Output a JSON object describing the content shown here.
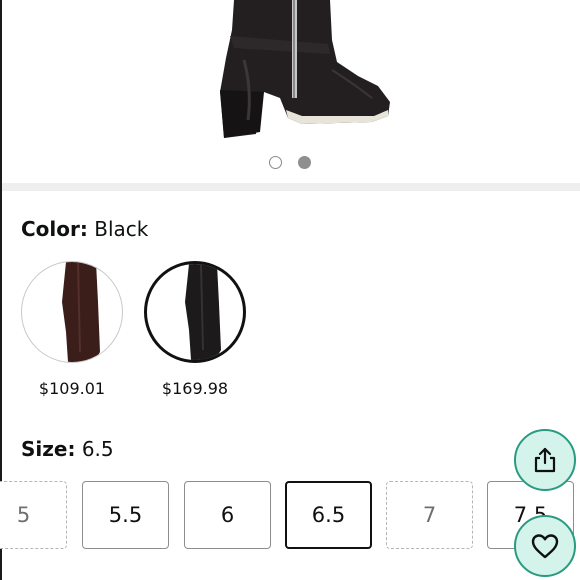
{
  "color": {
    "label": "Color:",
    "value": "Black"
  },
  "swatches": [
    {
      "price": "$109.01",
      "variant": "brown"
    },
    {
      "price": "$169.98",
      "variant": "black"
    }
  ],
  "size": {
    "label": "Size:",
    "value": "6.5",
    "options": [
      {
        "label": "5",
        "state": "unavailable"
      },
      {
        "label": "5.5",
        "state": "available"
      },
      {
        "label": "6",
        "state": "available"
      },
      {
        "label": "6.5",
        "state": "selected"
      },
      {
        "label": "7",
        "state": "unavailable"
      },
      {
        "label": "7.5",
        "state": "available"
      }
    ]
  },
  "carousel": {
    "count": 2,
    "active_index": 1
  },
  "actions": {
    "share_icon": "share-icon",
    "wishlist_icon": "heart-icon"
  },
  "colors": {
    "fab_fill": "#d4f3ea",
    "fab_border": "#2a9a80",
    "divider": "#eeeeee"
  }
}
